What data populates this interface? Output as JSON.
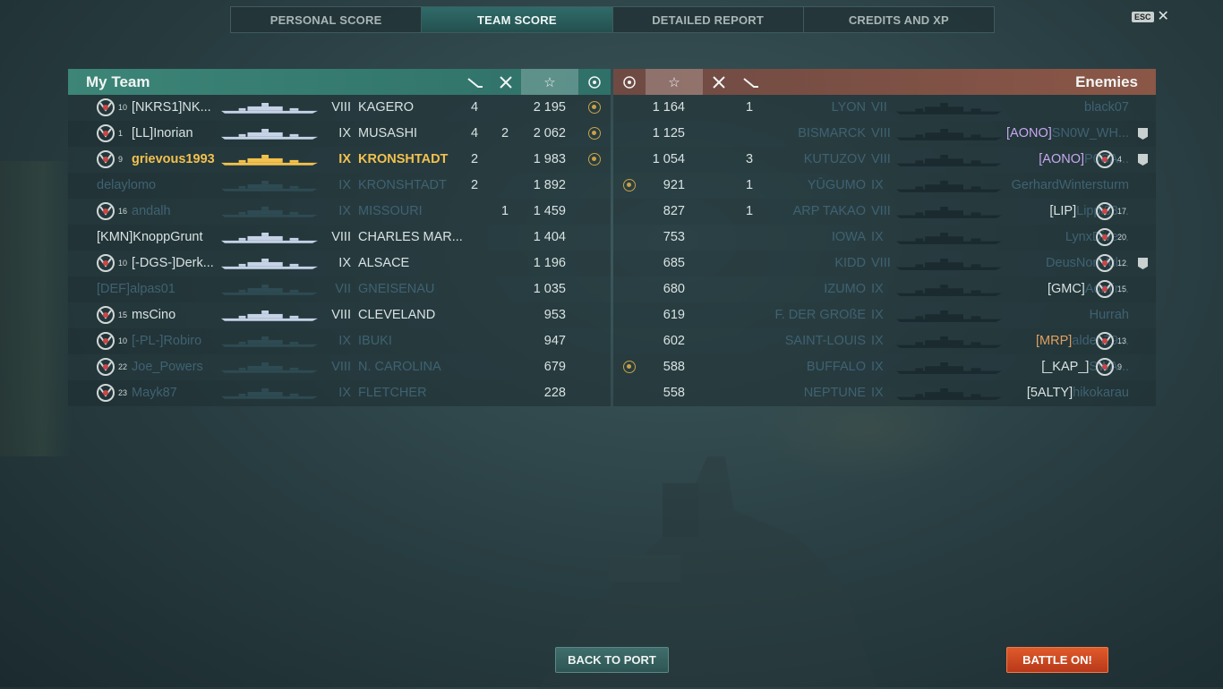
{
  "tabs": [
    {
      "label": "PERSONAL SCORE",
      "active": false
    },
    {
      "label": "TEAM SCORE",
      "active": true
    },
    {
      "label": "DETAILED REPORT",
      "active": false
    },
    {
      "label": "CREDITS AND XP",
      "active": false
    }
  ],
  "esc_label": "ESC",
  "my_team": {
    "title": "My Team",
    "rows": [
      {
        "rank": "10",
        "clan": "[NKRS1]",
        "name": "NK...",
        "tier": "VIII",
        "ship": "KAGERO",
        "c1": "4",
        "c2": "",
        "score": "2 195",
        "medal": true,
        "style": "norm"
      },
      {
        "rank": "1",
        "clan": "[LL]",
        "name": "Inorian",
        "tier": "IX",
        "ship": "MUSASHI",
        "c1": "4",
        "c2": "2",
        "score": "2 062",
        "medal": true,
        "style": "norm"
      },
      {
        "rank": "9",
        "clan": "",
        "name": "grievous1993",
        "tier": "IX",
        "ship": "KRONSHTADT",
        "c1": "2",
        "c2": "",
        "score": "1 983",
        "medal": true,
        "style": "hl"
      },
      {
        "rank": "",
        "clan": "",
        "name": "delaylomo",
        "tier": "IX",
        "ship": "KRONSHTADT",
        "c1": "2",
        "c2": "",
        "score": "1 892",
        "medal": false,
        "style": "dim"
      },
      {
        "rank": "16",
        "clan": "",
        "name": "andalh",
        "tier": "IX",
        "ship": "MISSOURI",
        "c1": "",
        "c2": "1",
        "score": "1 459",
        "medal": false,
        "style": "dim"
      },
      {
        "rank": "",
        "clan": "[KMN]",
        "name": "KnoppGrunt",
        "tier": "VIII",
        "ship": "CHARLES MAR...",
        "c1": "",
        "c2": "",
        "score": "1 404",
        "medal": false,
        "style": "norm"
      },
      {
        "rank": "10",
        "clan": "[-DGS-]",
        "name": "Derk...",
        "tier": "IX",
        "ship": "ALSACE",
        "c1": "",
        "c2": "",
        "score": "1 196",
        "medal": false,
        "style": "norm"
      },
      {
        "rank": "",
        "clan": "[DEF]",
        "name": "alpas01",
        "tier": "VII",
        "ship": "GNEISENAU",
        "c1": "",
        "c2": "",
        "score": "1 035",
        "medal": false,
        "style": "dim"
      },
      {
        "rank": "15",
        "clan": "",
        "name": "msCino",
        "tier": "VIII",
        "ship": "CLEVELAND",
        "c1": "",
        "c2": "",
        "score": "953",
        "medal": false,
        "style": "norm"
      },
      {
        "rank": "10",
        "clan": "[-PL-]",
        "name": "Robiro",
        "tier": "IX",
        "ship": "IBUKI",
        "c1": "",
        "c2": "",
        "score": "947",
        "medal": false,
        "style": "dim"
      },
      {
        "rank": "22",
        "clan": "",
        "name": "Joe_Powers",
        "tier": "VIII",
        "ship": "N. CAROLINA",
        "c1": "",
        "c2": "",
        "score": "679",
        "medal": false,
        "style": "dim"
      },
      {
        "rank": "23",
        "clan": "",
        "name": "Mayk87",
        "tier": "IX",
        "ship": "FLETCHER",
        "c1": "",
        "c2": "",
        "score": "228",
        "medal": false,
        "style": "dim"
      }
    ]
  },
  "enemies": {
    "title": "Enemies",
    "rows": [
      {
        "medal": false,
        "score": "1 164",
        "c2": "1",
        "ship": "LYON",
        "tier": "VII",
        "clan": "",
        "name": "black07",
        "rank": "",
        "badge": false,
        "style": "dim"
      },
      {
        "medal": false,
        "score": "1 125",
        "c2": "",
        "ship": "BISMARCK",
        "tier": "VIII",
        "clan": "[AONO]",
        "name": "SN0W_WH...",
        "rank": "",
        "badge": true,
        "style": "dim"
      },
      {
        "medal": false,
        "score": "1 054",
        "c2": "3",
        "ship": "KUTUZOV",
        "tier": "VIII",
        "clan": "[AONO]",
        "name": "P0CA...",
        "rank": "4",
        "badge": true,
        "style": "dim"
      },
      {
        "medal": true,
        "score": "921",
        "c2": "1",
        "ship": "YŪGUMO",
        "tier": "IX",
        "clan": "",
        "name": "GerhardWintersturm",
        "rank": "",
        "badge": false,
        "style": "dim"
      },
      {
        "medal": false,
        "score": "827",
        "c2": "1",
        "ship": "ARP TAKAO",
        "tier": "VIII",
        "clan": "[LIP]",
        "name": "Lippi33...",
        "rank": "17",
        "badge": false,
        "style": "dim"
      },
      {
        "medal": false,
        "score": "753",
        "c2": "",
        "ship": "IOWA",
        "tier": "IX",
        "clan": "",
        "name": "LynxDive...",
        "rank": "20",
        "badge": false,
        "style": "dim"
      },
      {
        "medal": false,
        "score": "685",
        "c2": "",
        "ship": "KIDD",
        "tier": "VIII",
        "clan": "",
        "name": "DeusNonVul...",
        "rank": "12",
        "badge": true,
        "style": "dim"
      },
      {
        "medal": false,
        "score": "680",
        "c2": "",
        "ship": "IZUMO",
        "tier": "IX",
        "clan": "[GMC]",
        "name": "Admir...",
        "rank": "15",
        "badge": false,
        "style": "dim"
      },
      {
        "medal": false,
        "score": "619",
        "c2": "",
        "ship": "F. DER GROßE",
        "tier": "IX",
        "clan": "",
        "name": "Hurrah",
        "rank": "",
        "badge": false,
        "style": "dim"
      },
      {
        "medal": false,
        "score": "602",
        "c2": "",
        "ship": "SAINT-LOUIS",
        "tier": "IX",
        "clan": "[MRP]",
        "name": "alden79...",
        "rank": "13",
        "badge": false,
        "style": "dim"
      },
      {
        "medal": true,
        "score": "588",
        "c2": "",
        "ship": "BUFFALO",
        "tier": "IX",
        "clan": "[_KAP_]",
        "name": "SWA...",
        "rank": "9",
        "badge": false,
        "style": "dim"
      },
      {
        "medal": false,
        "score": "558",
        "c2": "",
        "ship": "NEPTUNE",
        "tier": "IX",
        "clan": "[5ALTY]",
        "name": "hikokarau",
        "rank": "",
        "badge": false,
        "style": "dim"
      }
    ]
  },
  "icons": {
    "torpedo": "torpedo-icon",
    "plane": "plane-crossed-icon",
    "star": "star-icon",
    "medal": "medal-icon"
  },
  "buttons": {
    "back_to_port": "BACK TO PORT",
    "battle_on": "BATTLE ON!"
  },
  "colors": {
    "highlight": "#f2c14e",
    "my_team_header": "#3c8577",
    "enemy_header": "#8b5747",
    "battle_button": "#d24a22"
  }
}
